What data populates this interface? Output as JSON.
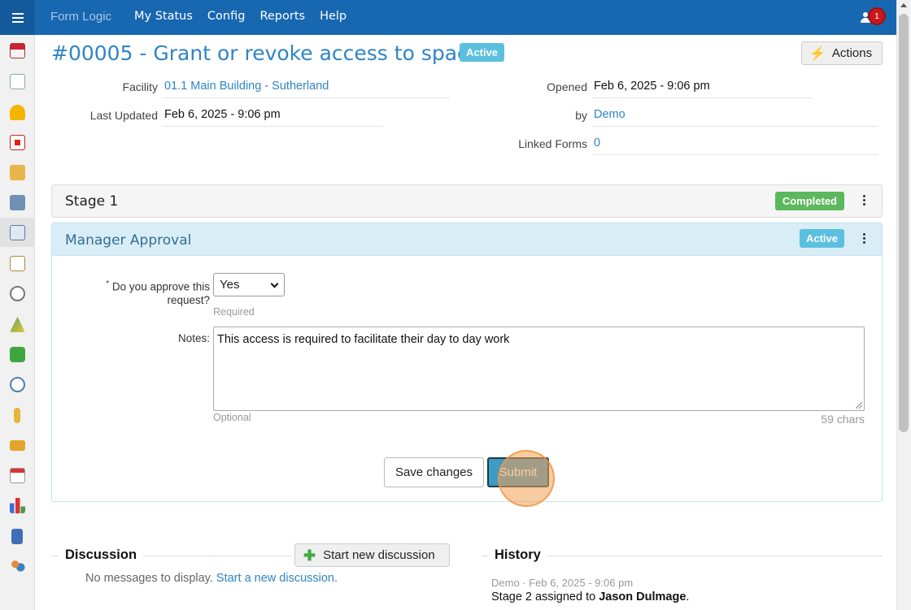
{
  "nav": {
    "brand": "Form Logic",
    "items": [
      "My Status",
      "Config",
      "Reports",
      "Help"
    ],
    "notifications": "1"
  },
  "sidebar": {
    "icons": [
      "home-icon",
      "documents-icon",
      "hardhat-icon",
      "first-aid-icon",
      "folder-icon",
      "building-icon",
      "forms-icon",
      "checklist-icon",
      "inspection-icon",
      "hazard-icon",
      "puzzle-icon",
      "alarm-clock-icon",
      "key-icon",
      "vehicle-icon",
      "calendar-icon",
      "bar-chart-icon",
      "help-book-icon",
      "users-icon"
    ]
  },
  "header": {
    "title": "#00005 - Grant or revoke access to space",
    "status": "Active",
    "actions_label": "Actions"
  },
  "details": {
    "facility_label": "Facility",
    "facility_value": "01.1 Main Building - Sutherland",
    "last_updated_label": "Last Updated",
    "last_updated_value": "Feb 6, 2025 - 9:06 pm",
    "opened_label": "Opened",
    "opened_value": "Feb 6, 2025 - 9:06 pm",
    "by_label": "by",
    "by_value": "Demo",
    "linked_forms_label": "Linked Forms",
    "linked_forms_value": "0"
  },
  "stage1": {
    "title": "Stage 1",
    "status": "Completed"
  },
  "manager_approval": {
    "title": "Manager Approval",
    "status": "Active",
    "question_required_marker": "*",
    "question_label": "Do you approve this request?",
    "answer": "Yes",
    "answer_help": "Required",
    "notes_label": "Notes:",
    "notes_value": "This access is required to facilitate their day to day work",
    "notes_help": "Optional",
    "chars": "59 chars",
    "save_label": "Save changes",
    "submit_label": "Submit"
  },
  "discussion": {
    "heading": "Discussion",
    "start_label": "Start new discussion",
    "empty_text": "No messages to display.",
    "empty_link": "Start a new discussion."
  },
  "history": {
    "heading": "History",
    "meta": "Demo · Feb 6, 2025 - 9:06 pm",
    "text_prefix": "Stage 2 assigned to",
    "text_name": "Jason Dulmage",
    "text_suffix": "."
  },
  "colors": {
    "nav_bg": "#1767b1",
    "title": "#2f84c4",
    "active_badge": "#5bc0de",
    "completed_badge": "#5cb85c",
    "info_panel": "#d9edf7"
  }
}
